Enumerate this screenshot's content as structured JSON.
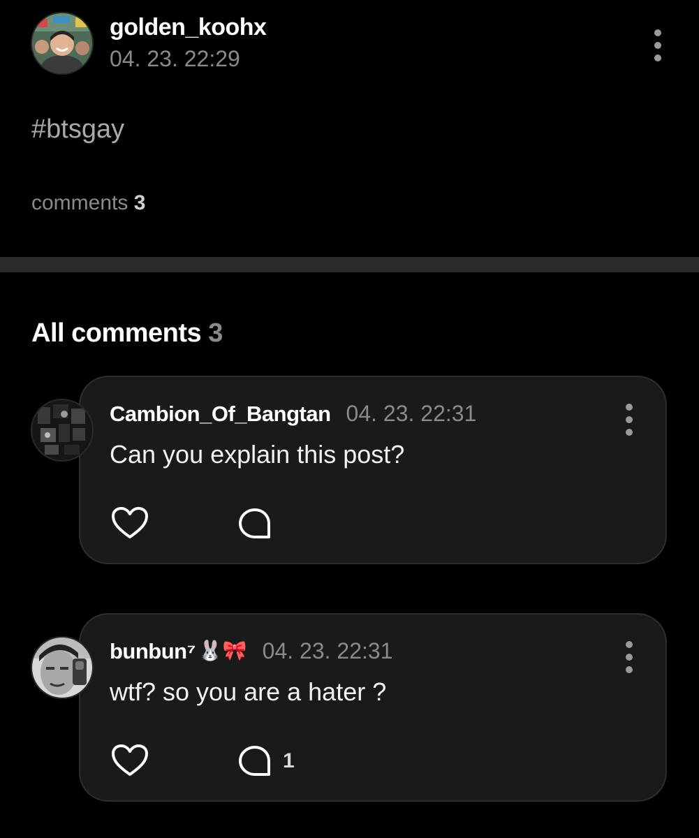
{
  "post": {
    "username": "golden_koohx",
    "timestamp": "04. 23. 22:29",
    "body": "#btsgay",
    "comments_label": "comments",
    "comments_count": "3",
    "menu_icon": "kebab-menu-icon"
  },
  "comments_section": {
    "title": "All comments",
    "count": "3"
  },
  "comments": [
    {
      "author": "Cambion_Of_Bangtan",
      "badge": "",
      "timestamp": "04. 23. 22:31",
      "text": "Can you explain this post?",
      "reply_count": ""
    },
    {
      "author": "bunbun⁷",
      "badge": "🐰🎀",
      "timestamp": "04. 23. 22:31",
      "text": "wtf? so you are a hater ?",
      "reply_count": "1"
    }
  ],
  "icons": {
    "like": "heart-outline-icon",
    "reply": "speech-bubble-icon",
    "menu": "kebab-menu-icon"
  },
  "colors": {
    "background": "#000000",
    "card": "#1a1a1a",
    "card_border": "#2e2e2e",
    "divider": "#2b2b2b",
    "muted_text": "#8a8a8a"
  }
}
